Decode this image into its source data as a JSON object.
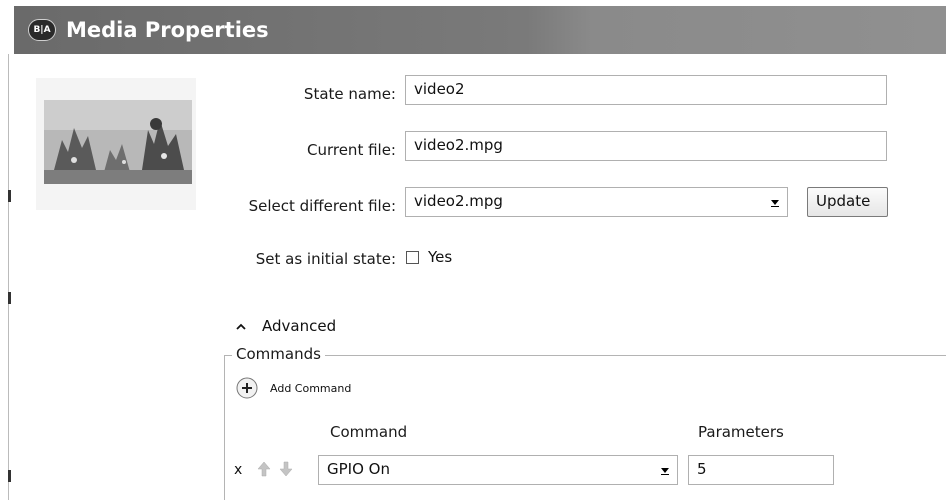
{
  "window": {
    "logo_text": "B|A",
    "title": "Media Properties"
  },
  "form": {
    "state_name_label": "State name:",
    "state_name_value": "video2",
    "current_file_label": "Current file:",
    "current_file_value": "video2.mpg",
    "select_file_label": "Select different file:",
    "select_file_value": "video2.mpg",
    "update_label": "Update",
    "initial_state_label": "Set as initial state:",
    "initial_state_option": "Yes",
    "initial_state_checked": false
  },
  "advanced": {
    "toggle_label": "Advanced",
    "commands_legend": "Commands",
    "add_command_label": "Add Command",
    "columns": [
      "Command",
      "Parameters"
    ],
    "rows": [
      {
        "remove_label": "x",
        "command": "GPIO On",
        "parameters": "5"
      }
    ]
  },
  "icons": {
    "logo": "brightauthor-logo-icon",
    "dropdown": "dropdown-arrow-icon",
    "collapse": "chevron-up-icon",
    "add": "plus-circle-icon",
    "move_up": "arrow-up-icon",
    "move_down": "arrow-down-icon",
    "remove": "remove-x-icon"
  }
}
